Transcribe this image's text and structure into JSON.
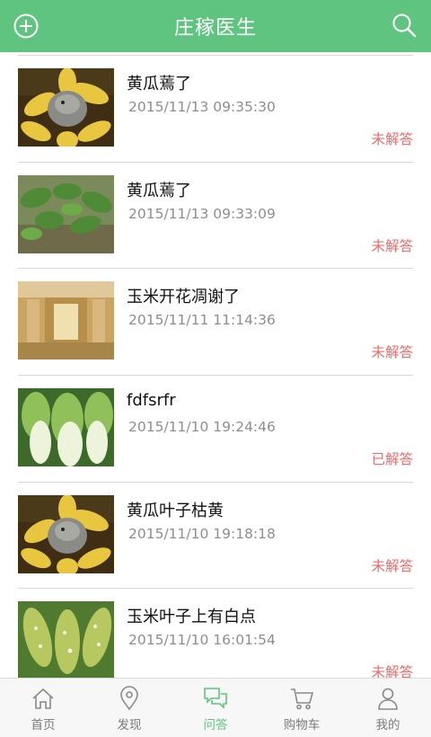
{
  "header": {
    "title": "庄稼医生",
    "add_icon": "plus-circle-icon",
    "search_icon": "search-icon",
    "color": "#5fc47f"
  },
  "questions": [
    {
      "title": "黄瓜蔫了",
      "time": "2015/11/13 09:35:30",
      "status": "未解答",
      "image": "sunflower-photo"
    },
    {
      "title": "黄瓜蔫了",
      "time": "2015/11/13 09:33:09",
      "status": "未解答",
      "image": "cucumber-plant-photo"
    },
    {
      "title": "玉米开花凋谢了",
      "time": "2015/11/11 11:14:36",
      "status": "未解答",
      "image": "interior-room-photo"
    },
    {
      "title": "fdfsrfr",
      "time": "2015/11/10 19:24:46",
      "status": "已解答",
      "image": "cabbage-photo"
    },
    {
      "title": "黄瓜叶子枯黄",
      "time": "2015/11/10 19:18:18",
      "status": "未解答",
      "image": "sunflower-photo"
    },
    {
      "title": "玉米叶子上有白点",
      "time": "2015/11/10 16:01:54",
      "status": "未解答",
      "image": "spotted-leaves-photo"
    }
  ],
  "tabs": [
    {
      "label": "首页",
      "icon": "home-icon",
      "active": false
    },
    {
      "label": "发现",
      "icon": "location-pin-icon",
      "active": false
    },
    {
      "label": "问答",
      "icon": "chat-bubbles-icon",
      "active": true
    },
    {
      "label": "购物车",
      "icon": "shopping-cart-icon",
      "active": false
    },
    {
      "label": "我的",
      "icon": "user-icon",
      "active": false
    }
  ],
  "colors": {
    "accent": "#5fc47f",
    "status": "#f26a6a",
    "muted": "#8e8e8e"
  }
}
